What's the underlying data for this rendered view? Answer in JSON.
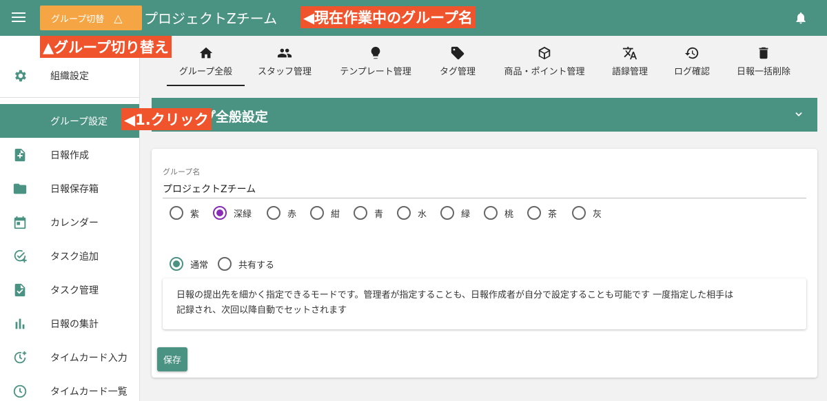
{
  "header": {
    "group_switch_label": "グループ切替",
    "group_switch_icon": "warning-triangle-icon",
    "team_name": "プロジェクトZチーム",
    "bell_icon": "bell-icon"
  },
  "annotations": {
    "current_group": "◀現在作業中のグループ名",
    "group_switch": "▲グループ切り替え",
    "click": "◀1.クリック"
  },
  "sidebar": {
    "items": [
      {
        "label": "組織設定",
        "icon": "gear-icon"
      },
      {
        "label": "グループ設定",
        "icon": "none",
        "active": true
      },
      {
        "label": "日報作成",
        "icon": "file-plus-icon"
      },
      {
        "label": "日報保存箱",
        "icon": "folder-icon"
      },
      {
        "label": "カレンダー",
        "icon": "calendar-icon"
      },
      {
        "label": "タスク追加",
        "icon": "check-plus-icon"
      },
      {
        "label": "タスク管理",
        "icon": "file-check-icon"
      },
      {
        "label": "日報の集計",
        "icon": "bar-chart-icon"
      },
      {
        "label": "タイムカード入力",
        "icon": "clock-plus-icon"
      },
      {
        "label": "タイムカード一覧",
        "icon": "clock-icon"
      }
    ]
  },
  "tabs": [
    {
      "label": "グループ全般",
      "icon": "home-icon",
      "active": true
    },
    {
      "label": "スタッフ管理",
      "icon": "people-icon"
    },
    {
      "label": "テンプレート管理",
      "icon": "lightbulb-icon"
    },
    {
      "label": "タグ管理",
      "icon": "tag-icon"
    },
    {
      "label": "商品・ポイント管理",
      "icon": "box-icon"
    },
    {
      "label": "語録管理",
      "icon": "translate-icon"
    },
    {
      "label": "ログ確認",
      "icon": "history-icon"
    },
    {
      "label": "日報一括削除",
      "icon": "trash-icon"
    }
  ],
  "section": {
    "title": "グループ全般設定",
    "chevron_icon": "chevron-down-icon"
  },
  "form": {
    "group_name_label": "グループ名",
    "group_name_value": "プロジェクトZチーム",
    "colors": [
      "紫",
      "深緑",
      "赤",
      "紺",
      "青",
      "水",
      "緑",
      "桃",
      "茶",
      "灰"
    ],
    "selected_color": "深緑",
    "modes": [
      "通常",
      "共有する"
    ],
    "selected_mode": "通常",
    "description_line1": "日報の提出先を細かく指定できるモードです。管理者が指定することも、日報作成者が自分で設定することも可能です 一度指定した相手は",
    "description_line2": "記録され、次回以降自動でセットされます",
    "save_label": "保存"
  },
  "colors": {
    "primary": "#4a9383",
    "accent_orange": "#f6a545",
    "callout_red": "#f0542d",
    "radio_selected": "#8a2bb5"
  }
}
